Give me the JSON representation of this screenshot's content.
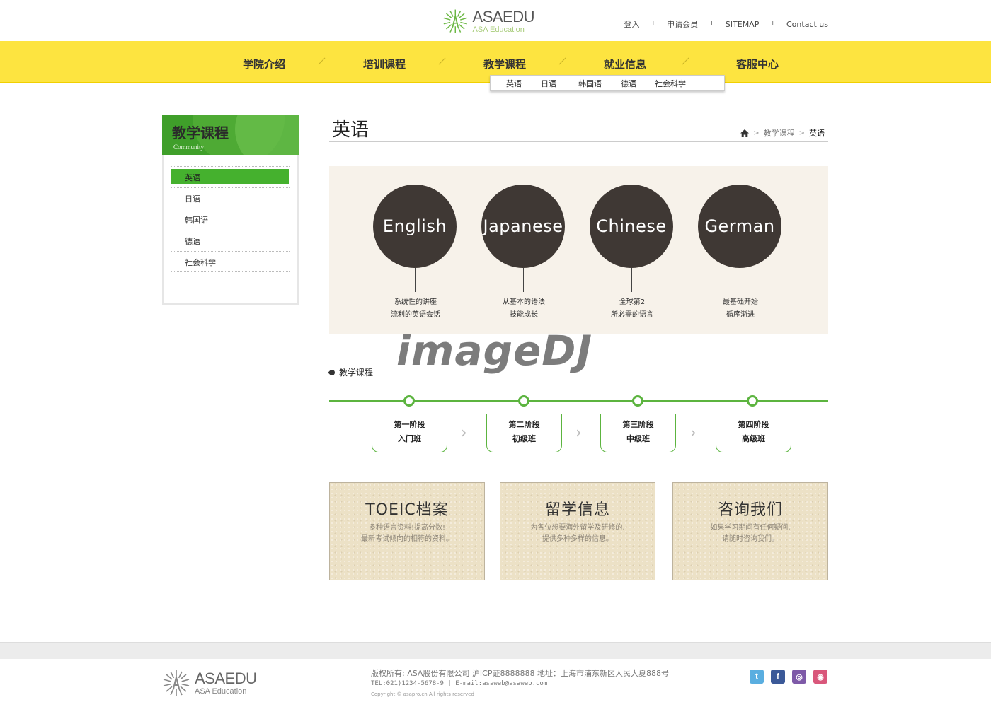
{
  "header": {
    "logo_main": "ASAEDU",
    "logo_sub": "ASA Education",
    "util_links": [
      "登入",
      "申请会员",
      "SITEMAP",
      "Contact us"
    ],
    "util_separator": "I"
  },
  "gnb": {
    "items": [
      "学院介绍",
      "培训课程",
      "教学课程",
      "就业信息",
      "客服中心"
    ],
    "background_color": "#fde440"
  },
  "subnav": {
    "items": [
      "英语",
      "日语",
      "韩国语",
      "德语",
      "社会科学"
    ]
  },
  "sidebar": {
    "title": "教学课程",
    "subtitle": "Community",
    "items": [
      {
        "label": "英语",
        "active": true
      },
      {
        "label": "日语",
        "active": false
      },
      {
        "label": "韩国语",
        "active": false
      },
      {
        "label": "德语",
        "active": false
      },
      {
        "label": "社会科学",
        "active": false
      }
    ],
    "accent_color": "#45b12e"
  },
  "content": {
    "page_title": "英语",
    "breadcrumb": {
      "home_icon": "home-icon",
      "items": [
        "教学课程",
        "英语"
      ]
    }
  },
  "languages": [
    {
      "name": "English",
      "desc_line1": "系统性的讲座",
      "desc_line2": "流利的英语会话"
    },
    {
      "name": "Japanese",
      "desc_line1": "从基本的语法",
      "desc_line2": "技能成长"
    },
    {
      "name": "Chinese",
      "desc_line1": "全球第2",
      "desc_line2": "所必需的语言"
    },
    {
      "name": "German",
      "desc_line1": "最基础开始",
      "desc_line2": "循序渐进"
    }
  ],
  "course": {
    "section_label": "教学课程",
    "steps": [
      {
        "stage": "第一阶段",
        "level": "入门班"
      },
      {
        "stage": "第二阶段",
        "level": "初级班"
      },
      {
        "stage": "第三阶段",
        "level": "中级班"
      },
      {
        "stage": "第四阶段",
        "level": "高级班"
      }
    ],
    "track_color": "#5cb43f"
  },
  "watermark": "imageDJ",
  "boxes": [
    {
      "title": "TOEIC档案",
      "desc_line1": "多种语言资料!提高分数!",
      "desc_line2": "最新考试倾向的相符的资料。"
    },
    {
      "title": "留学信息",
      "desc_line1": "为各位想要海外留学及研修的,",
      "desc_line2": "提供多种多样的信息。"
    },
    {
      "title": "咨询我们",
      "desc_line1": "如果学习期间有任何疑问,",
      "desc_line2": "请随时咨询我们。"
    }
  ],
  "footer": {
    "logo_main": "ASAEDU",
    "logo_sub": "ASA Education",
    "line1": "版权所有: ASA股份有限公司 沪ICP证8888888 地址：上海市浦东新区人民大夏888号",
    "line2": "TEL:021)1234-5678-9  |  E-mail:asaweb@asaweb.com",
    "line3": "Copyright © asapro.cn All rights reserved",
    "social": [
      {
        "icon": "twitter-icon",
        "glyph": "t",
        "color": "#5aaee0"
      },
      {
        "icon": "facebook-icon",
        "glyph": "f",
        "color": "#3b5998"
      },
      {
        "icon": "community-icon",
        "glyph": "◎",
        "color": "#7e5aa8"
      },
      {
        "icon": "blog-icon",
        "glyph": "◉",
        "color": "#d9577b"
      }
    ]
  }
}
